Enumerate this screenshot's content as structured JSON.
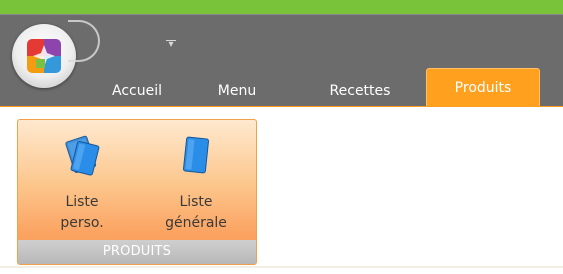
{
  "tabs": [
    {
      "label": "Accueil",
      "active": false
    },
    {
      "label": "Menu",
      "active": false
    },
    {
      "label": "Recettes",
      "active": false
    },
    {
      "label": "Produits",
      "active": true
    }
  ],
  "ribbon": {
    "group_label": "PRODUITS",
    "buttons": [
      {
        "line1": "Liste",
        "line2": "perso.",
        "icon": "document-icon"
      },
      {
        "line1": "Liste",
        "line2": "générale",
        "icon": "document-icon"
      }
    ]
  },
  "colors": {
    "top_banner": "#78c33a",
    "titlebar": "#6c6c6c",
    "active_tab": "#ffa11e",
    "icon_blue": "#2a8de8",
    "group_label_bg": "#b8b8b8"
  }
}
